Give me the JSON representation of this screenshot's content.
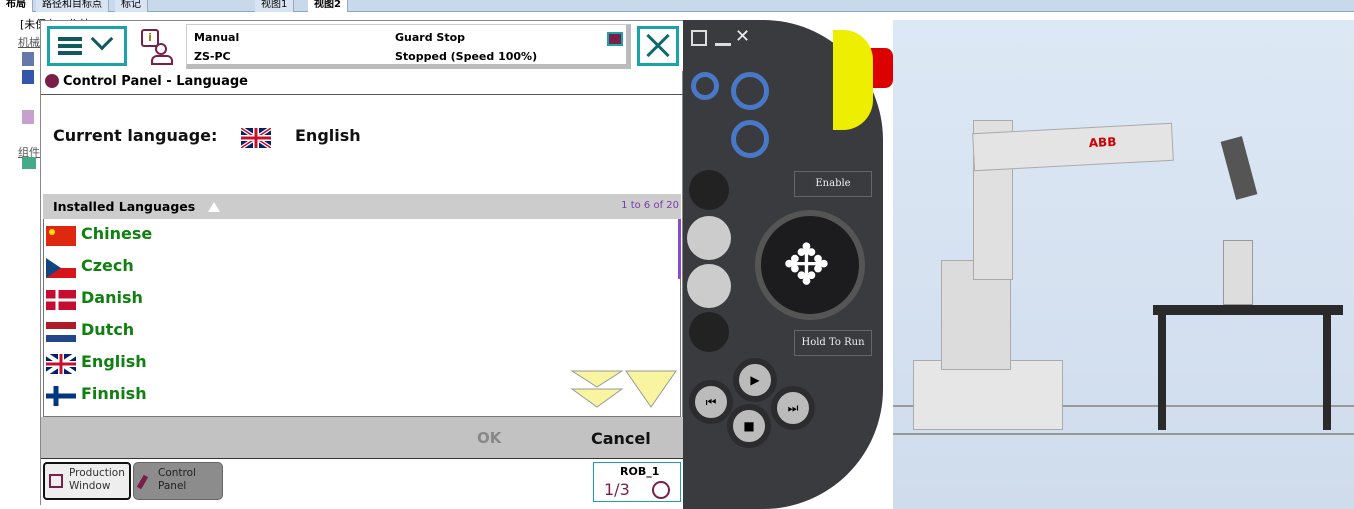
{
  "tabs": [
    "布局",
    "路径和目标点",
    "标记",
    "视图1",
    "视图2"
  ],
  "dock": {
    "station": "[未保存工作站]",
    "group1": "机械",
    "group2": "组件"
  },
  "header": {
    "mode": "Manual",
    "controller": "ZS-PC",
    "state": "Guard Stop",
    "run_state": "Stopped (Speed 100%)"
  },
  "title": "Control Panel - Language",
  "current": {
    "label": "Current language:",
    "value": "English"
  },
  "list": {
    "header": "Installed Languages",
    "range": "1 to 6 of 20",
    "items": [
      {
        "name": "Chinese",
        "flag": "cn"
      },
      {
        "name": "Czech",
        "flag": "cz"
      },
      {
        "name": "Danish",
        "flag": "dk"
      },
      {
        "name": "Dutch",
        "flag": "nl"
      },
      {
        "name": "English",
        "flag": "gb"
      },
      {
        "name": "Finnish",
        "flag": "fi"
      }
    ]
  },
  "buttons": {
    "ok": "OK",
    "cancel": "Cancel"
  },
  "taskbar": {
    "production": "Production Window",
    "control": "Control Panel",
    "robot": "ROB_1",
    "speed": "1/3"
  },
  "pendant": {
    "enable": "Enable",
    "hold": "Hold To Run"
  },
  "scene": {
    "logo": "ABB"
  },
  "colors": {
    "accent": "#1aa3a8",
    "text_green": "#108010",
    "brand": "#7a1f4a"
  }
}
